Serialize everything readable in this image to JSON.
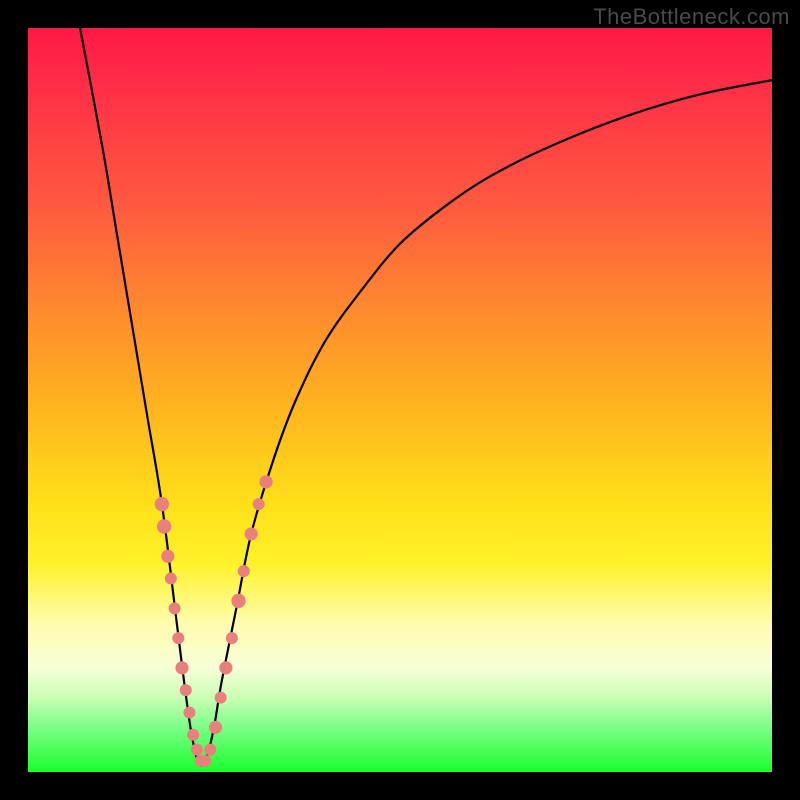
{
  "watermark": "TheBottleneck.com",
  "chart_data": {
    "type": "line",
    "title": "",
    "xlabel": "",
    "ylabel": "",
    "xlim": [
      0,
      100
    ],
    "ylim": [
      0,
      100
    ],
    "curve": {
      "comment": "Single black V-shaped curve; y approximates percent height from bottom. Minimum near x≈23.",
      "x": [
        7,
        10,
        12,
        14,
        16,
        18,
        20,
        21,
        22,
        23,
        24,
        25,
        26,
        28,
        30,
        33,
        36,
        40,
        45,
        50,
        56,
        62,
        70,
        80,
        90,
        100
      ],
      "y": [
        100,
        84,
        72,
        60,
        48,
        36,
        20,
        12,
        5,
        1,
        2,
        6,
        12,
        22,
        32,
        42,
        50,
        58,
        65,
        71,
        76,
        80,
        84,
        88,
        91,
        93
      ]
    },
    "dots": {
      "comment": "Salmon-pink dots clustered near the bottom of the V on both branches",
      "points": [
        {
          "x": 18.0,
          "y": 36,
          "r": 1.2
        },
        {
          "x": 18.3,
          "y": 33,
          "r": 1.2
        },
        {
          "x": 18.8,
          "y": 29,
          "r": 1.1
        },
        {
          "x": 19.2,
          "y": 26,
          "r": 1.0
        },
        {
          "x": 19.7,
          "y": 22,
          "r": 1.0
        },
        {
          "x": 20.2,
          "y": 18,
          "r": 1.0
        },
        {
          "x": 20.7,
          "y": 14,
          "r": 1.1
        },
        {
          "x": 21.2,
          "y": 11,
          "r": 1.0
        },
        {
          "x": 21.7,
          "y": 8,
          "r": 1.0
        },
        {
          "x": 22.2,
          "y": 5,
          "r": 1.0
        },
        {
          "x": 22.7,
          "y": 3,
          "r": 1.0
        },
        {
          "x": 23.2,
          "y": 1.5,
          "r": 1.0
        },
        {
          "x": 23.8,
          "y": 1.5,
          "r": 1.0
        },
        {
          "x": 24.5,
          "y": 3,
          "r": 1.0
        },
        {
          "x": 25.2,
          "y": 6,
          "r": 1.1
        },
        {
          "x": 25.9,
          "y": 10,
          "r": 1.0
        },
        {
          "x": 26.6,
          "y": 14,
          "r": 1.1
        },
        {
          "x": 27.4,
          "y": 18,
          "r": 1.0
        },
        {
          "x": 28.3,
          "y": 23,
          "r": 1.2
        },
        {
          "x": 29.0,
          "y": 27,
          "r": 1.0
        },
        {
          "x": 30.0,
          "y": 32,
          "r": 1.1
        },
        {
          "x": 31.0,
          "y": 36,
          "r": 1.0
        },
        {
          "x": 32.0,
          "y": 39,
          "r": 1.1
        }
      ],
      "color": "#e9807e"
    }
  }
}
